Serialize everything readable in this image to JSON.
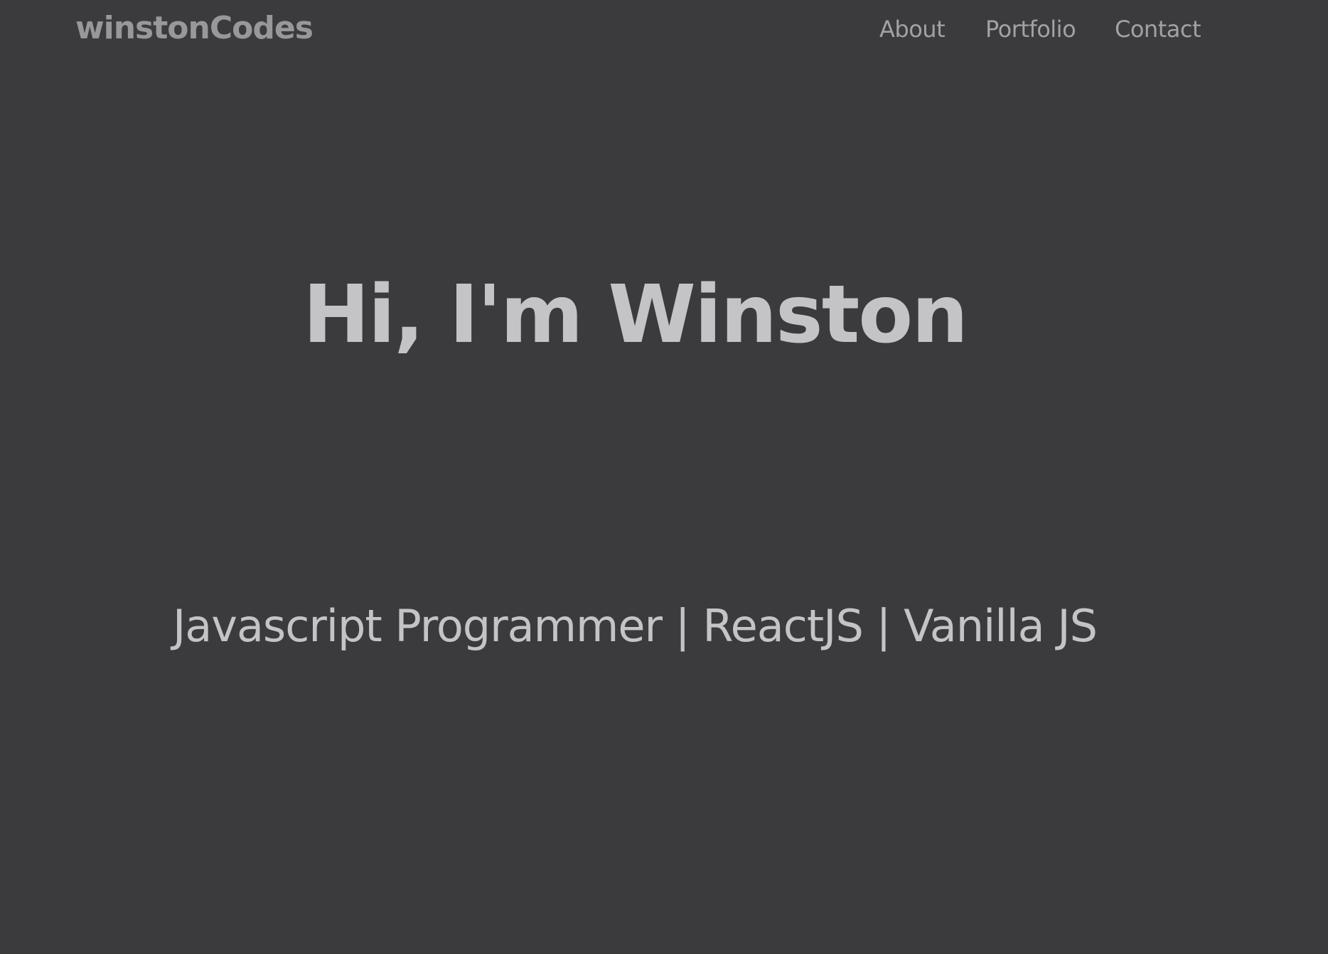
{
  "header": {
    "logo": "winstonCodes",
    "nav": {
      "about": "About",
      "portfolio": "Portfolio",
      "contact": "Contact"
    }
  },
  "hero": {
    "title": "Hi, I'm Winston",
    "subtitle": "Javascript Programmer | ReactJS | Vanilla JS"
  },
  "colors": {
    "background": "#3b3b3d",
    "logo": "#98989b",
    "nav_text": "#a2a2a5",
    "hero_text": "#c4c4c7"
  }
}
